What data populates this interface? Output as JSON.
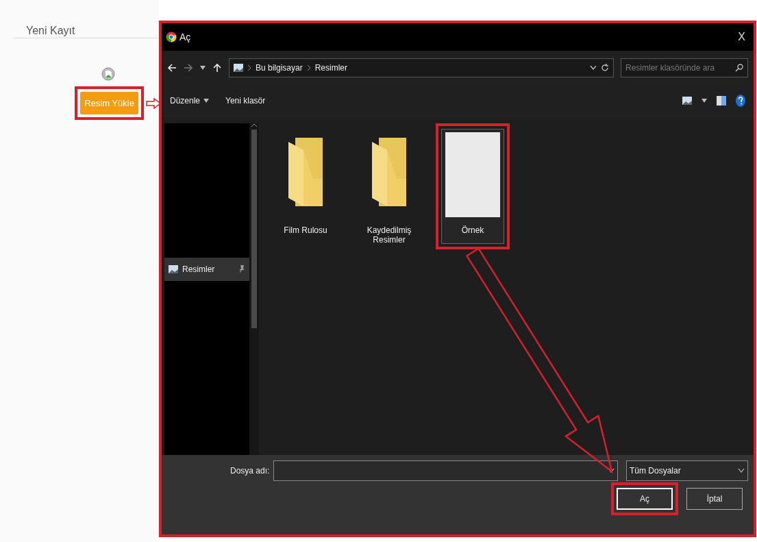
{
  "page": {
    "title": "Yeni Kayıt",
    "upload_button": {
      "label": "Resim Yükle",
      "highlighted": true
    }
  },
  "dialog": {
    "title": "Aç",
    "close": "X",
    "breadcrumb": [
      "Bu bilgisayar",
      "Resimler"
    ],
    "search": {
      "placeholder": "Resimler klasöründe ara"
    },
    "toolbar": [
      {
        "label": "Düzenle",
        "kind": "menu"
      },
      {
        "label": "Yeni klasör",
        "kind": "plain"
      }
    ],
    "nav_pane": [
      {
        "label": "Resimler",
        "pinned": true
      }
    ],
    "files": [
      {
        "name": "Film Rulosu",
        "kind": "folder",
        "selected": false,
        "highlighted": false
      },
      {
        "name": "Kaydedilmiş Resimler",
        "kind": "folder",
        "selected": false,
        "highlighted": false
      },
      {
        "name": "Örnek",
        "kind": "image",
        "selected": true,
        "highlighted": true
      }
    ],
    "filename_label": "Dosya adı:",
    "file_type": "Tüm Dosyalar",
    "buttons": [
      {
        "label": "Aç",
        "focused": true,
        "highlighted": true
      },
      {
        "label": "İptal",
        "focused": false,
        "highlighted": false
      }
    ]
  }
}
